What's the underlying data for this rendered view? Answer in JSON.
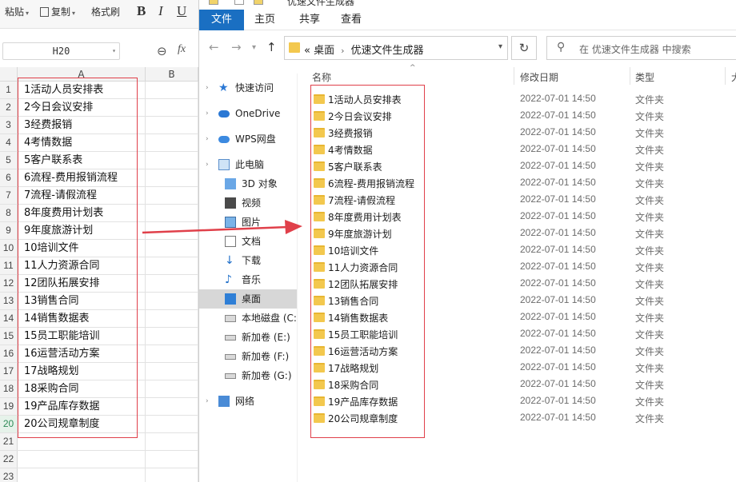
{
  "spreadsheet": {
    "toolbar": {
      "paste_label": "粘贴",
      "copy_label": "复制",
      "format_painter_label": "格式刷",
      "bold": "B",
      "italic": "I",
      "underline": "U"
    },
    "name_box": "H20",
    "zoom_icon": "zoom-icon",
    "fx_label": "fx",
    "columns": [
      "A",
      "B"
    ],
    "rows": [
      {
        "num": "1",
        "a": "1活动人员安排表"
      },
      {
        "num": "2",
        "a": "2今日会议安排"
      },
      {
        "num": "3",
        "a": "3经费报销"
      },
      {
        "num": "4",
        "a": "4考情数据"
      },
      {
        "num": "5",
        "a": "5客户联系表"
      },
      {
        "num": "6",
        "a": "6流程-费用报销流程"
      },
      {
        "num": "7",
        "a": "7流程-请假流程"
      },
      {
        "num": "8",
        "a": "8年度费用计划表"
      },
      {
        "num": "9",
        "a": "9年度旅游计划"
      },
      {
        "num": "10",
        "a": "10培训文件"
      },
      {
        "num": "11",
        "a": "11人力资源合同"
      },
      {
        "num": "12",
        "a": "12团队拓展安排"
      },
      {
        "num": "13",
        "a": "13销售合同"
      },
      {
        "num": "14",
        "a": "14销售数据表"
      },
      {
        "num": "15",
        "a": "15员工职能培训"
      },
      {
        "num": "16",
        "a": "16运营活动方案"
      },
      {
        "num": "17",
        "a": "17战略规划"
      },
      {
        "num": "18",
        "a": "18采购合同"
      },
      {
        "num": "19",
        "a": "19产品库存数据"
      },
      {
        "num": "20",
        "a": "20公司规章制度"
      },
      {
        "num": "21",
        "a": ""
      },
      {
        "num": "22",
        "a": ""
      },
      {
        "num": "23",
        "a": ""
      }
    ],
    "selected_row": "20"
  },
  "explorer": {
    "title": "优速文件生成器",
    "ribbon_tabs": [
      "文件",
      "主页",
      "共享",
      "查看"
    ],
    "address": {
      "prefix": "«",
      "crumbs": [
        "桌面",
        "优速文件生成器"
      ]
    },
    "search_placeholder": "在 优速文件生成器 中搜索",
    "nav_items": [
      {
        "label": "快速访问",
        "icon": "star-icon"
      },
      {
        "label": "OneDrive",
        "icon": "cloud-icon"
      },
      {
        "label": "WPS网盘",
        "icon": "wps-cloud-icon"
      },
      {
        "label": "此电脑",
        "icon": "computer-icon"
      },
      {
        "label": "3D 对象",
        "icon": "cube-icon"
      },
      {
        "label": "视频",
        "icon": "video-icon"
      },
      {
        "label": "图片",
        "icon": "picture-icon"
      },
      {
        "label": "文档",
        "icon": "document-icon"
      },
      {
        "label": "下载",
        "icon": "download-icon"
      },
      {
        "label": "音乐",
        "icon": "music-icon"
      },
      {
        "label": "桌面",
        "icon": "desktop-icon"
      },
      {
        "label": "本地磁盘 (C:",
        "icon": "disk-icon"
      },
      {
        "label": "新加卷 (E:)",
        "icon": "drive-icon"
      },
      {
        "label": "新加卷 (F:)",
        "icon": "drive-icon"
      },
      {
        "label": "新加卷 (G:)",
        "icon": "drive-icon"
      },
      {
        "label": "网络",
        "icon": "network-icon"
      }
    ],
    "active_nav": "桌面",
    "columns": {
      "name": "名称",
      "date": "修改日期",
      "type": "类型",
      "size": "大"
    },
    "files": [
      {
        "name": "1活动人员安排表",
        "date": "2022-07-01 14:50",
        "type": "文件夹"
      },
      {
        "name": "2今日会议安排",
        "date": "2022-07-01 14:50",
        "type": "文件夹"
      },
      {
        "name": "3经费报销",
        "date": "2022-07-01 14:50",
        "type": "文件夹"
      },
      {
        "name": "4考情数据",
        "date": "2022-07-01 14:50",
        "type": "文件夹"
      },
      {
        "name": "5客户联系表",
        "date": "2022-07-01 14:50",
        "type": "文件夹"
      },
      {
        "name": "6流程-费用报销流程",
        "date": "2022-07-01 14:50",
        "type": "文件夹"
      },
      {
        "name": "7流程-请假流程",
        "date": "2022-07-01 14:50",
        "type": "文件夹"
      },
      {
        "name": "8年度费用计划表",
        "date": "2022-07-01 14:50",
        "type": "文件夹"
      },
      {
        "name": "9年度旅游计划",
        "date": "2022-07-01 14:50",
        "type": "文件夹"
      },
      {
        "name": "10培训文件",
        "date": "2022-07-01 14:50",
        "type": "文件夹"
      },
      {
        "name": "11人力资源合同",
        "date": "2022-07-01 14:50",
        "type": "文件夹"
      },
      {
        "name": "12团队拓展安排",
        "date": "2022-07-01 14:50",
        "type": "文件夹"
      },
      {
        "name": "13销售合同",
        "date": "2022-07-01 14:50",
        "type": "文件夹"
      },
      {
        "name": "14销售数据表",
        "date": "2022-07-01 14:50",
        "type": "文件夹"
      },
      {
        "name": "15员工职能培训",
        "date": "2022-07-01 14:50",
        "type": "文件夹"
      },
      {
        "name": "16运营活动方案",
        "date": "2022-07-01 14:50",
        "type": "文件夹"
      },
      {
        "name": "17战略规划",
        "date": "2022-07-01 14:50",
        "type": "文件夹"
      },
      {
        "name": "18采购合同",
        "date": "2022-07-01 14:50",
        "type": "文件夹"
      },
      {
        "name": "19产品库存数据",
        "date": "2022-07-01 14:50",
        "type": "文件夹"
      },
      {
        "name": "20公司规章制度",
        "date": "2022-07-01 14:50",
        "type": "文件夹"
      }
    ]
  },
  "colors": {
    "highlight_box": "#e0404a",
    "arrow": "#e0404a",
    "ribbon_active": "#1a6fc2",
    "folder": "#f3c84e"
  }
}
